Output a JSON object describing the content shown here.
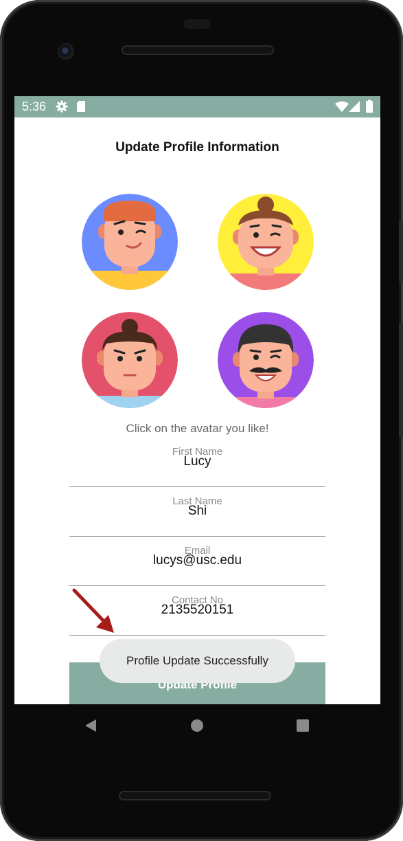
{
  "status_bar": {
    "time": "5:36",
    "icons": [
      "gear-icon",
      "sd-card-icon",
      "wifi-icon",
      "cell-signal-icon",
      "battery-icon"
    ]
  },
  "page": {
    "title": "Update Profile Information",
    "avatar_hint": "Click on the avatar you like!"
  },
  "avatars": [
    {
      "name": "avatar-redhead-man",
      "background": "#6b8cff"
    },
    {
      "name": "avatar-bun-woman",
      "background": "#ffef3a"
    },
    {
      "name": "avatar-topknot-man",
      "background": "#e4516b"
    },
    {
      "name": "avatar-mustache-man",
      "background": "#9b4fe8"
    }
  ],
  "form": {
    "first_name": {
      "label": "First Name",
      "value": "Lucy"
    },
    "last_name": {
      "label": "Last Name",
      "value": "Shi"
    },
    "email": {
      "label": "Email",
      "value": "lucys@usc.edu"
    },
    "contact_no": {
      "label": "Contact No",
      "value": "2135520151"
    },
    "submit_label": "Update Profile"
  },
  "toast": {
    "message": "Profile Update Successfully"
  },
  "colors": {
    "accent": "#87ada2",
    "arrow": "#a61e1a"
  }
}
